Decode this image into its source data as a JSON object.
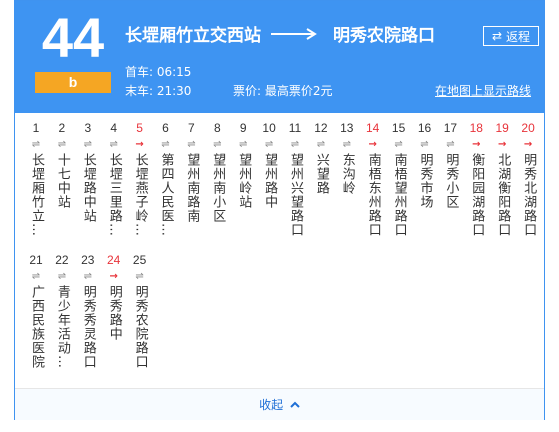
{
  "route": {
    "number": "44",
    "badge": "b"
  },
  "direction": {
    "from": "长堽厢竹立交西站",
    "to": "明秀农院路口"
  },
  "return_label": "返程",
  "first_bus": "首车: 06:15",
  "last_bus": "末车: 21:30",
  "fare": "票价: 最高票价2元",
  "map_link": "在地图上显示路线",
  "collapse_label": "收起",
  "colors": {
    "header": "#3e94f2",
    "badge": "#f5a623",
    "highlight": "#e8343b"
  },
  "stops": [
    {
      "num": "1",
      "name": "长堽厢竹立…",
      "arrow": "⇌",
      "hl": false
    },
    {
      "num": "2",
      "name": "十七中站",
      "arrow": "⇌",
      "hl": false
    },
    {
      "num": "3",
      "name": "长堽路中站",
      "arrow": "⇌",
      "hl": false
    },
    {
      "num": "4",
      "name": "长堽三里路…",
      "arrow": "⇌",
      "hl": false
    },
    {
      "num": "5",
      "name": "长堽燕子岭…",
      "arrow": "→",
      "hl": true
    },
    {
      "num": "6",
      "name": "第四人民医…",
      "arrow": "⇌",
      "hl": false
    },
    {
      "num": "7",
      "name": "望州南路南",
      "arrow": "⇌",
      "hl": false
    },
    {
      "num": "8",
      "name": "望州南小区",
      "arrow": "⇌",
      "hl": false
    },
    {
      "num": "9",
      "name": "望州岭站",
      "arrow": "⇌",
      "hl": false
    },
    {
      "num": "10",
      "name": "望州路中",
      "arrow": "⇌",
      "hl": false
    },
    {
      "num": "11",
      "name": "望州兴望路口",
      "arrow": "⇌",
      "hl": false
    },
    {
      "num": "12",
      "name": "兴望路",
      "arrow": "⇌",
      "hl": false
    },
    {
      "num": "13",
      "name": "东沟岭",
      "arrow": "⇌",
      "hl": false
    },
    {
      "num": "14",
      "name": "南梧东州路口",
      "arrow": "→",
      "hl": true
    },
    {
      "num": "15",
      "name": "南梧望州路口",
      "arrow": "⇌",
      "hl": false
    },
    {
      "num": "16",
      "name": "明秀市场",
      "arrow": "⇌",
      "hl": false
    },
    {
      "num": "17",
      "name": "明秀小区",
      "arrow": "⇌",
      "hl": false
    },
    {
      "num": "18",
      "name": "衡阳园湖路口",
      "arrow": "→",
      "hl": true
    },
    {
      "num": "19",
      "name": "北湖衡阳路口",
      "arrow": "→",
      "hl": true
    },
    {
      "num": "20",
      "name": "明秀北湖路口",
      "arrow": "→",
      "hl": true
    },
    {
      "num": "21",
      "name": "广西民族医院",
      "arrow": "⇌",
      "hl": false
    },
    {
      "num": "22",
      "name": "青少年活动…",
      "arrow": "⇌",
      "hl": false
    },
    {
      "num": "23",
      "name": "明秀秀灵路口",
      "arrow": "⇌",
      "hl": false
    },
    {
      "num": "24",
      "name": "明秀路中",
      "arrow": "→",
      "hl": true
    },
    {
      "num": "25",
      "name": "明秀农院路口",
      "arrow": "⇌",
      "hl": false
    }
  ]
}
